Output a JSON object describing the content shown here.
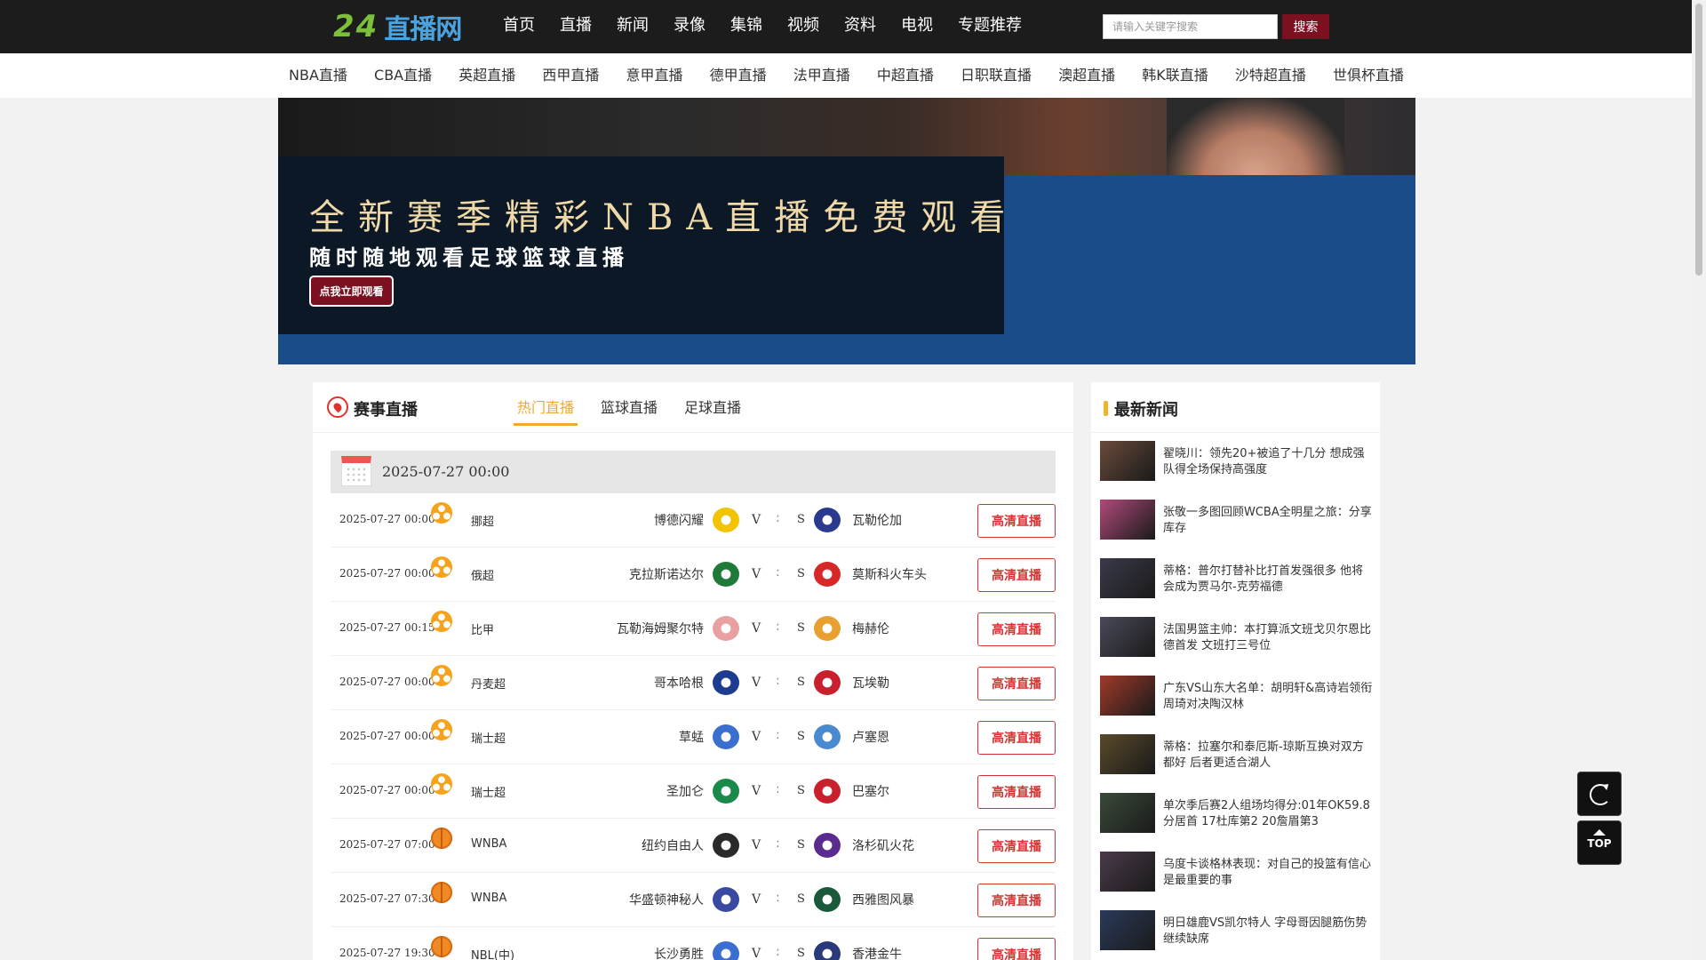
{
  "header": {
    "logo_number": "24",
    "logo_text": "直播网",
    "nav": [
      "首页",
      "直播",
      "新闻",
      "录像",
      "集锦",
      "视频",
      "资料",
      "电视",
      "专题推荐"
    ],
    "search": {
      "placeholder": "请输入关键字搜索",
      "button": "搜索"
    }
  },
  "subnav": [
    "NBA直播",
    "CBA直播",
    "英超直播",
    "西甲直播",
    "意甲直播",
    "德甲直播",
    "法甲直播",
    "中超直播",
    "日职联直播",
    "澳超直播",
    "韩K联直播",
    "沙特超直播",
    "世俱杯直播"
  ],
  "banner": {
    "title": "全新赛季精彩NBA直播免费观看",
    "subtitle": "随时随地观看足球篮球直播",
    "button": "点我立即观看"
  },
  "matches": {
    "title": "赛事直播",
    "tabs": [
      "热门直播",
      "篮球直播",
      "足球直播"
    ],
    "active_tab": 0,
    "date": "2025-07-27 00:00",
    "vs_v": "V",
    "vs_colon": ":",
    "vs_s": "S",
    "rows": [
      {
        "time": "2025-07-27 00:00",
        "sport": "football",
        "league": "挪超",
        "home": "博德闪耀",
        "away": "瓦勒伦加",
        "home_color": "#f2c400",
        "away_color": "#2a3b8f",
        "button": "高清直播"
      },
      {
        "time": "2025-07-27 00:00",
        "sport": "football",
        "league": "俄超",
        "home": "克拉斯诺达尔",
        "away": "莫斯科火车头",
        "home_color": "#1f7a3a",
        "away_color": "#d62828",
        "button": "高清直播"
      },
      {
        "time": "2025-07-27 00:15",
        "sport": "football",
        "league": "比甲",
        "home": "瓦勒海姆聚尔特",
        "away": "梅赫伦",
        "home_color": "#e8a0a0",
        "away_color": "#e8a030",
        "button": "高清直播"
      },
      {
        "time": "2025-07-27 00:00",
        "sport": "football",
        "league": "丹麦超",
        "home": "哥本哈根",
        "away": "瓦埃勒",
        "home_color": "#1d3c8f",
        "away_color": "#c8202c",
        "button": "高清直播"
      },
      {
        "time": "2025-07-27 00:00",
        "sport": "football",
        "league": "瑞士超",
        "home": "草蜢",
        "away": "卢塞恩",
        "home_color": "#3a6fd0",
        "away_color": "#4a8ad0",
        "button": "高清直播"
      },
      {
        "time": "2025-07-27 00:00",
        "sport": "football",
        "league": "瑞士超",
        "home": "圣加仑",
        "away": "巴塞尔",
        "home_color": "#1a8a4a",
        "away_color": "#c8202c",
        "button": "高清直播"
      },
      {
        "time": "2025-07-27 07:00",
        "sport": "basketball",
        "league": "WNBA",
        "home": "纽约自由人",
        "away": "洛杉矶火花",
        "home_color": "#2a2a2a",
        "away_color": "#5a2a8f",
        "button": "高清直播"
      },
      {
        "time": "2025-07-27 07:30",
        "sport": "basketball",
        "league": "WNBA",
        "home": "华盛顿神秘人",
        "away": "西雅图风暴",
        "home_color": "#3a4aa0",
        "away_color": "#1a5a3a",
        "button": "高清直播"
      },
      {
        "time": "2025-07-27 19:30",
        "sport": "basketball",
        "league": "NBL(中)",
        "home": "长沙勇胜",
        "away": "香港金牛",
        "home_color": "#3a6fd0",
        "away_color": "#2a3a7a",
        "button": "高清直播"
      }
    ]
  },
  "news": {
    "title": "最新新闻",
    "items": [
      {
        "text": "翟晓川：领先20+被追了十几分 想成强队得全场保持高强度",
        "thumb": "#6a4a3a"
      },
      {
        "text": "张敬一多图回顾WCBA全明星之旅：分享库存",
        "thumb": "#b04a7a"
      },
      {
        "text": "蒂格：普尔打替补比打首发强很多 他将会成为贾马尔-克劳福德",
        "thumb": "#3a3a4a"
      },
      {
        "text": "法国男篮主帅：本打算派文班戈贝尔恩比德首发 文班打三号位",
        "thumb": "#4a4a5a"
      },
      {
        "text": "广东VS山东大名单：胡明轩&高诗岩领衔 周琦对决陶汉林",
        "thumb": "#a03a2a"
      },
      {
        "text": "蒂格：拉塞尔和泰厄斯-琼斯互换对双方都好 后者更适合湖人",
        "thumb": "#5a4a2a"
      },
      {
        "text": "单次季后赛2人组场均得分:01年OK59.8分居首 17杜库第2 20詹眉第3",
        "thumb": "#3a4a3a"
      },
      {
        "text": "乌度卡谈格林表现：对自己的投篮有信心是最重要的事",
        "thumb": "#4a3a4a"
      },
      {
        "text": "明日雄鹿VS凯尔特人 字母哥因腿筋伤势继续缺席",
        "thumb": "#2a3a5a"
      }
    ]
  },
  "float": {
    "top_label": "TOP"
  }
}
